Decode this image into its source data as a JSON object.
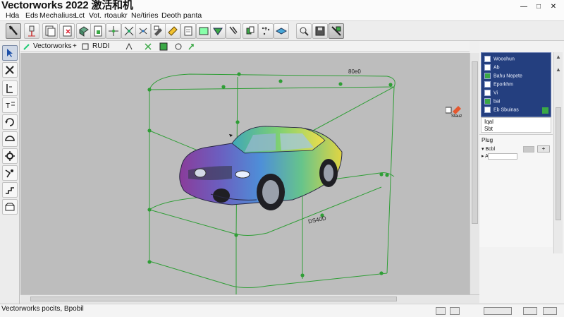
{
  "window": {
    "title": "Vectorworks 2022 激活和机",
    "controls": {
      "minimize": "—",
      "maximize": "□",
      "close": "✕"
    }
  },
  "menu": [
    "Hda",
    "Eds",
    "Mechaliuss",
    "Lct",
    "Vot.",
    "rtoaukr",
    "Ne/tiries",
    "Deoth panta"
  ],
  "toolbar": {
    "icons": [
      "select-arrow-icon",
      "push-pin-icon",
      "document-stack-icon",
      "document-star-icon",
      "cube-tool-icon",
      "page-green-icon",
      "snap-cross-icon",
      "snap-arrows-icon",
      "eraser-icon",
      "pencil-grid-icon",
      "document-edit-icon",
      "green-dropdown-icon",
      "wrench-icon",
      "cube-green-icon",
      "sparkle-dots-icon",
      "diamond-layer-icon",
      "zoom-rect-icon",
      "save-floppy-icon",
      "navigate-cube-icon"
    ]
  },
  "viewbar": {
    "label": "Vectorworks",
    "label2": "RUDI",
    "plus": "+",
    "icons": [
      "magic-wand-icon",
      "view-cube-icon",
      "snap-icon",
      "camera-icon",
      "grid-icon",
      "navigator-icon",
      "render-icon"
    ]
  },
  "tools": {
    "icons": [
      "arrow-select-icon",
      "reshape-icon",
      "cross-tool-icon",
      "text-tool-icon",
      "dimension-icon",
      "rotate-icon",
      "layer-tool-icon",
      "gear-tool-icon",
      "move-tool-icon",
      "stair-tool-icon",
      "wall-tool-icon"
    ]
  },
  "drawing": {
    "dim_label_top": "80e0",
    "dim_label_bottom": "DS40D"
  },
  "resources": {
    "rows": [
      {
        "label": "Wooohun",
        "icon": "folder-icon"
      },
      {
        "label": "Ab",
        "icon": "document-icon"
      },
      {
        "label": "Bahu Nepete",
        "icon": "layer-green-icon"
      },
      {
        "label": "Eporkhm",
        "icon": "document-icon"
      },
      {
        "label": "Vi",
        "icon": "document-icon"
      },
      {
        "label": "bai",
        "icon": "document-green-icon"
      },
      {
        "label": "Eb Sbuinas",
        "icon": "document-icon"
      }
    ],
    "footer": [
      "Iqal",
      "Sbt"
    ]
  },
  "float_icon_label": "Stauz",
  "object_info": {
    "title": "Plug",
    "rows": [
      "Bcbl",
      "A"
    ],
    "add_button": "+"
  },
  "status": {
    "text": "Vectorworks pocits, Bpobil"
  }
}
